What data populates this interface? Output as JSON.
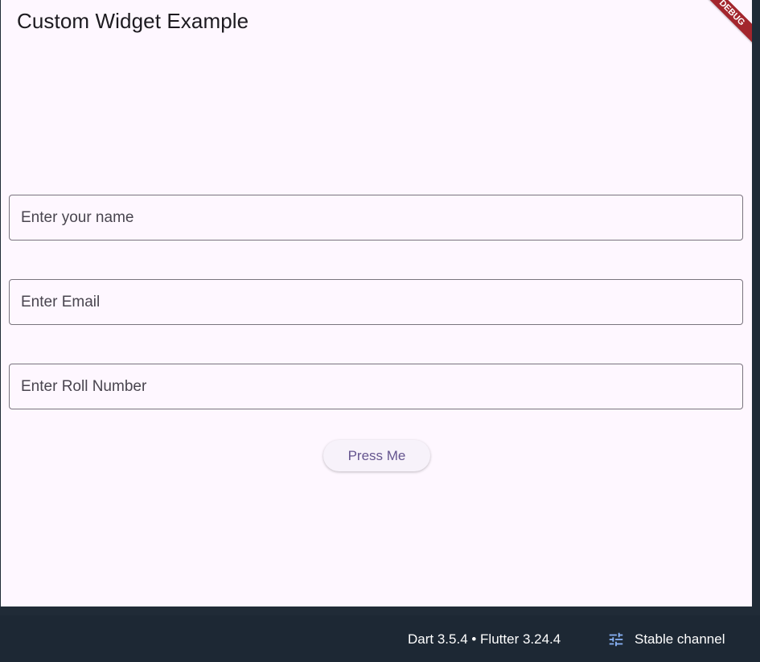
{
  "app": {
    "title": "Custom Widget Example",
    "debug_banner": "DEBUG"
  },
  "form": {
    "name_placeholder": "Enter your name",
    "email_placeholder": "Enter Email",
    "roll_placeholder": "Enter Roll Number",
    "button_label": "Press Me"
  },
  "footer": {
    "version_text": "Dart 3.5.4 • Flutter 3.24.4",
    "channel_icon": "tune-icon",
    "channel_label": "Stable channel"
  },
  "colors": {
    "app_background": "#fef7ff",
    "button_text": "#65558f",
    "debug_banner": "#a3262d",
    "footer_background": "#1d2834"
  }
}
